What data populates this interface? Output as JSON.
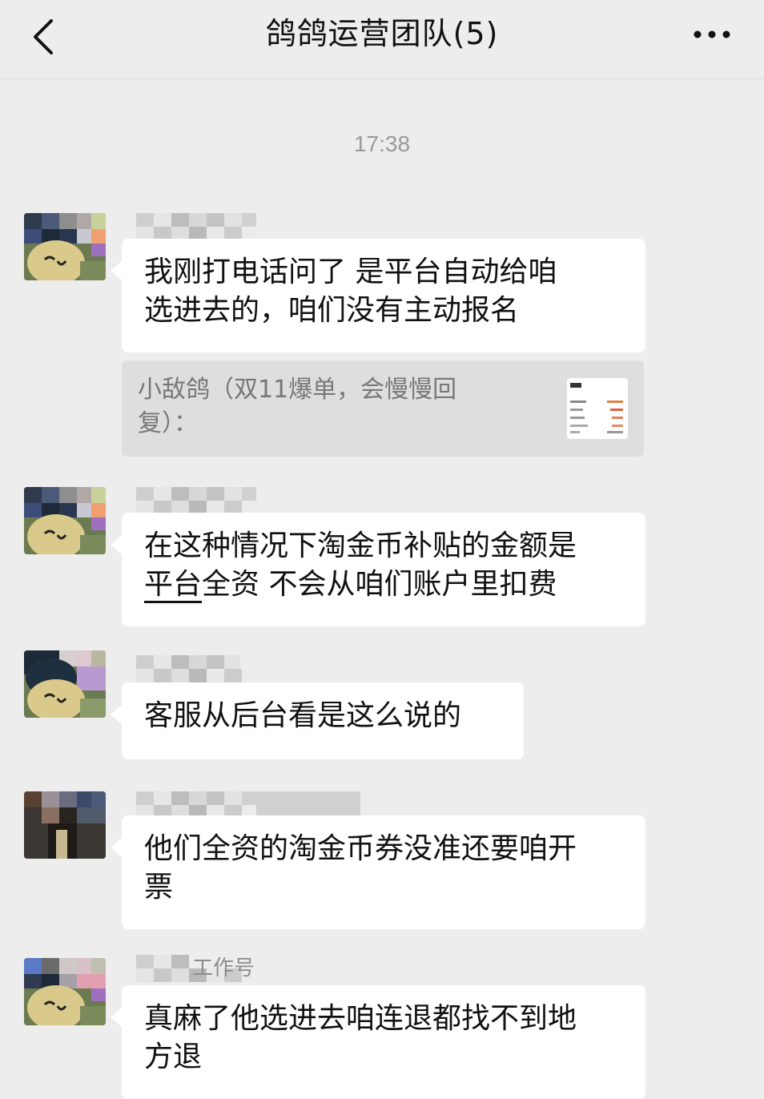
{
  "header": {
    "title": "鸽鸽运营团队(5)",
    "back_icon": "chevron-left-icon",
    "more_icon": "more-dots-icon"
  },
  "timestamp": "17:38",
  "messages": [
    {
      "text_line1": "我刚打电话问了 是平台自动给咱",
      "text_line2": "选进去的，咱们没有主动报名",
      "quote": {
        "text": "小敌鸽（双11爆单，会慢慢回复）："
      }
    },
    {
      "text_line1": "在这种情况下淘金币补贴的金额是",
      "text_line2_part1": "平台",
      "text_line2_part2": "全资 不会从咱们账户里扣费"
    },
    {
      "text_line1": "客服从后台看是这么说的"
    },
    {
      "text_line1": "他们全资的淘金币券没准还要咱开",
      "text_line2": "票"
    },
    {
      "sender_suffix": "工作号",
      "text_line1": "真麻了他选进去咱连退都找不到地",
      "text_line2": "方退"
    }
  ]
}
